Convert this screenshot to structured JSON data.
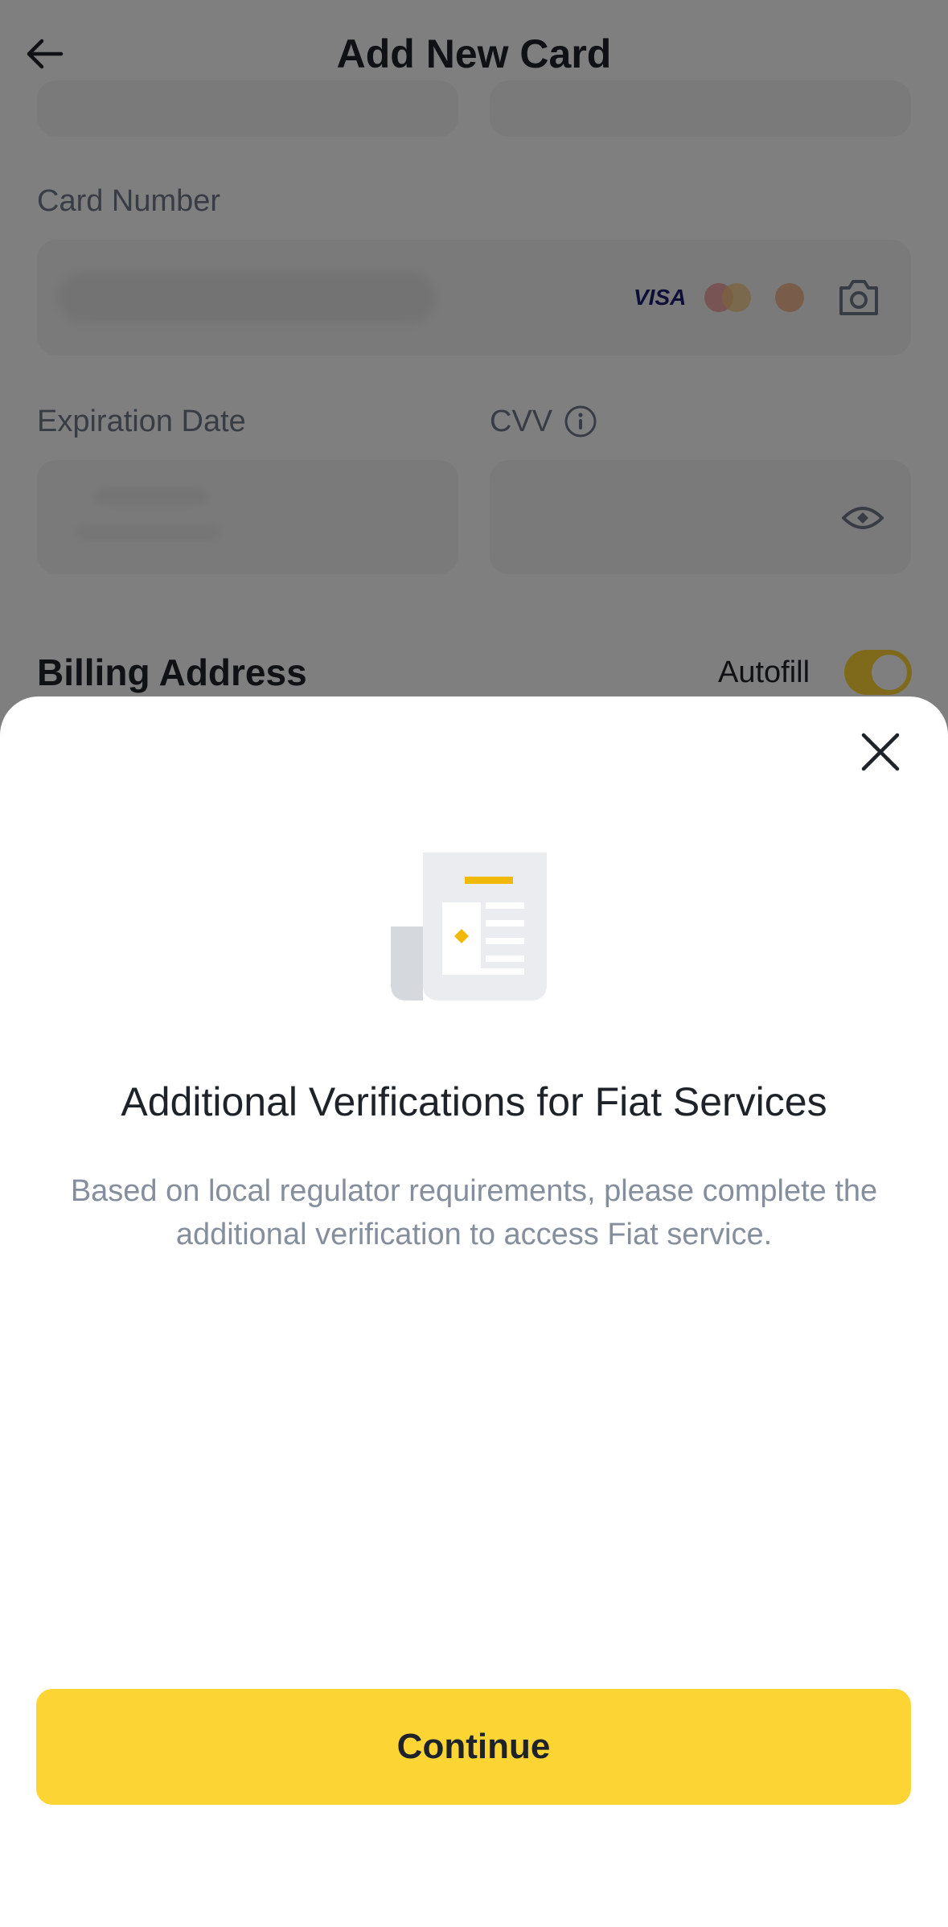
{
  "header": {
    "title": "Add New Card",
    "back_icon": "arrow-left-icon"
  },
  "form": {
    "card_number_label": "Card Number",
    "card_brands": {
      "visa": "VISA",
      "mastercard_icon": "mastercard-icon",
      "other_icon": "card-brand-icon"
    },
    "camera_icon": "camera-icon",
    "expiration_label": "Expiration Date",
    "cvv_label": "CVV",
    "cvv_info_icon": "info-icon",
    "eye_icon": "eye-icon"
  },
  "billing": {
    "title": "Billing Address",
    "autofill_label": "Autofill",
    "autofill_enabled": true
  },
  "sheet": {
    "close_icon": "close-icon",
    "illustration_icon": "document-illustration-icon",
    "title": "Additional Verifications for Fiat Services",
    "description": "Based on local regulator requirements, please complete the additional verification to access Fiat service.",
    "continue_label": "Continue"
  },
  "colors": {
    "accent": "#fcd535",
    "text_primary": "#1e2329",
    "text_secondary": "#848e9c",
    "field_background": "#f5f5f5"
  }
}
